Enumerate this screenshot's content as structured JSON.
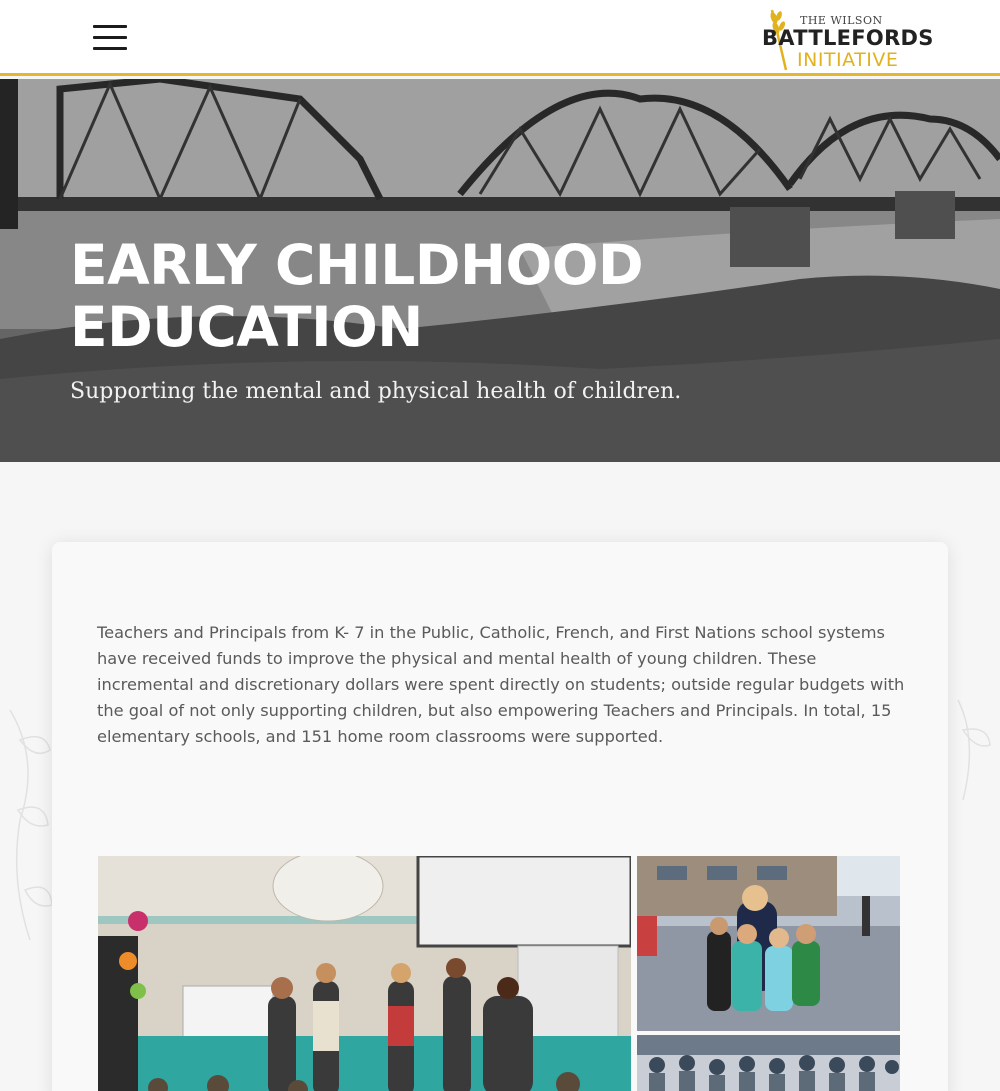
{
  "header": {
    "menu_label": "Menu",
    "logo": {
      "line1": "THE WILSON",
      "line2": "BATTLEFORDS",
      "line3": "INITIATIVE"
    }
  },
  "hero": {
    "title": "EARLY CHILDHOOD EDUCATION",
    "subtitle": "Supporting the mental and physical health of children."
  },
  "content": {
    "body": "Teachers and Principals from  K- 7 in the Public, Catholic, French, and First Nations school systems  have received funds to improve the physical and mental health of young children. These incremental and discretionary dollars were spent directly on students; outside regular budgets with the goal of not only supporting children, but also empowering Teachers and Principals. In total, 15 elementary schools, and 151 home room classrooms were supported."
  },
  "gallery": {
    "photos": [
      {
        "name": "gym-cheque-presentation-photo"
      },
      {
        "name": "children-street-photo"
      },
      {
        "name": "crowd-photo"
      }
    ]
  },
  "colors": {
    "accent": "#e3b82f",
    "text": "#5a5a5a",
    "header_bg": "#ffffff",
    "page_bg": "#f6f6f6"
  }
}
